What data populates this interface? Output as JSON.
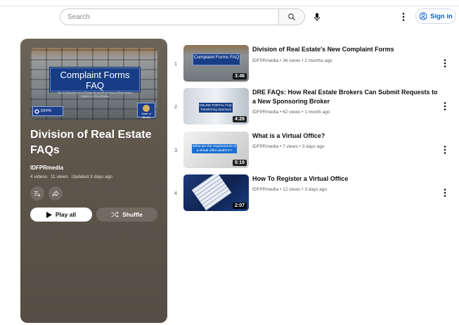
{
  "header": {
    "search_placeholder": "Search",
    "sign_in_label": "Sign in"
  },
  "playlist": {
    "thumbnail": {
      "title": "Complaint Forms FAQ",
      "subtitle_lines": [
        "Illinois Department of Financial and Professional Regulation",
        "Division of Real Estate"
      ],
      "logo_text": "IDFPR",
      "seal_text": "State of Illinois"
    },
    "title": "Division of Real Estate FAQs",
    "owner": "IDFPRmedia",
    "videos_count": "4 videos",
    "views_count": "11 views",
    "updated": "Updated 3 days ago",
    "play_all_label": "Play all",
    "shuffle_label": "Shuffle"
  },
  "videos": [
    {
      "index": "1",
      "title": "Division of Real Estate's New Complaint Forms",
      "channel": "IDFPRmedia",
      "views": "38 views",
      "age": "2 months ago",
      "duration": "3:46",
      "thumb_text": "Complaint Forms FAQ"
    },
    {
      "index": "2",
      "title": "DRE FAQs: How Real Estate Brokers Can Submit Requests to a New Sponsoring Broker",
      "channel": "IDFPRmedia",
      "views": "62 views",
      "age": "1 month ago",
      "duration": "4:26",
      "thumb_text": "ONLINE PORTAL FAQ: Transferring Sponsors"
    },
    {
      "index": "3",
      "title": "What is a Virtual Office?",
      "channel": "IDFPRmedia",
      "views": "7 views",
      "age": "3 days ago",
      "duration": "5:19",
      "thumb_text": "What are the requirements of a virtual office platform?"
    },
    {
      "index": "4",
      "title": "How To Register a Virtual Office",
      "channel": "IDFPRmedia",
      "views": "12 views",
      "age": "3 days ago",
      "duration": "2:07"
    }
  ],
  "separator": "•"
}
